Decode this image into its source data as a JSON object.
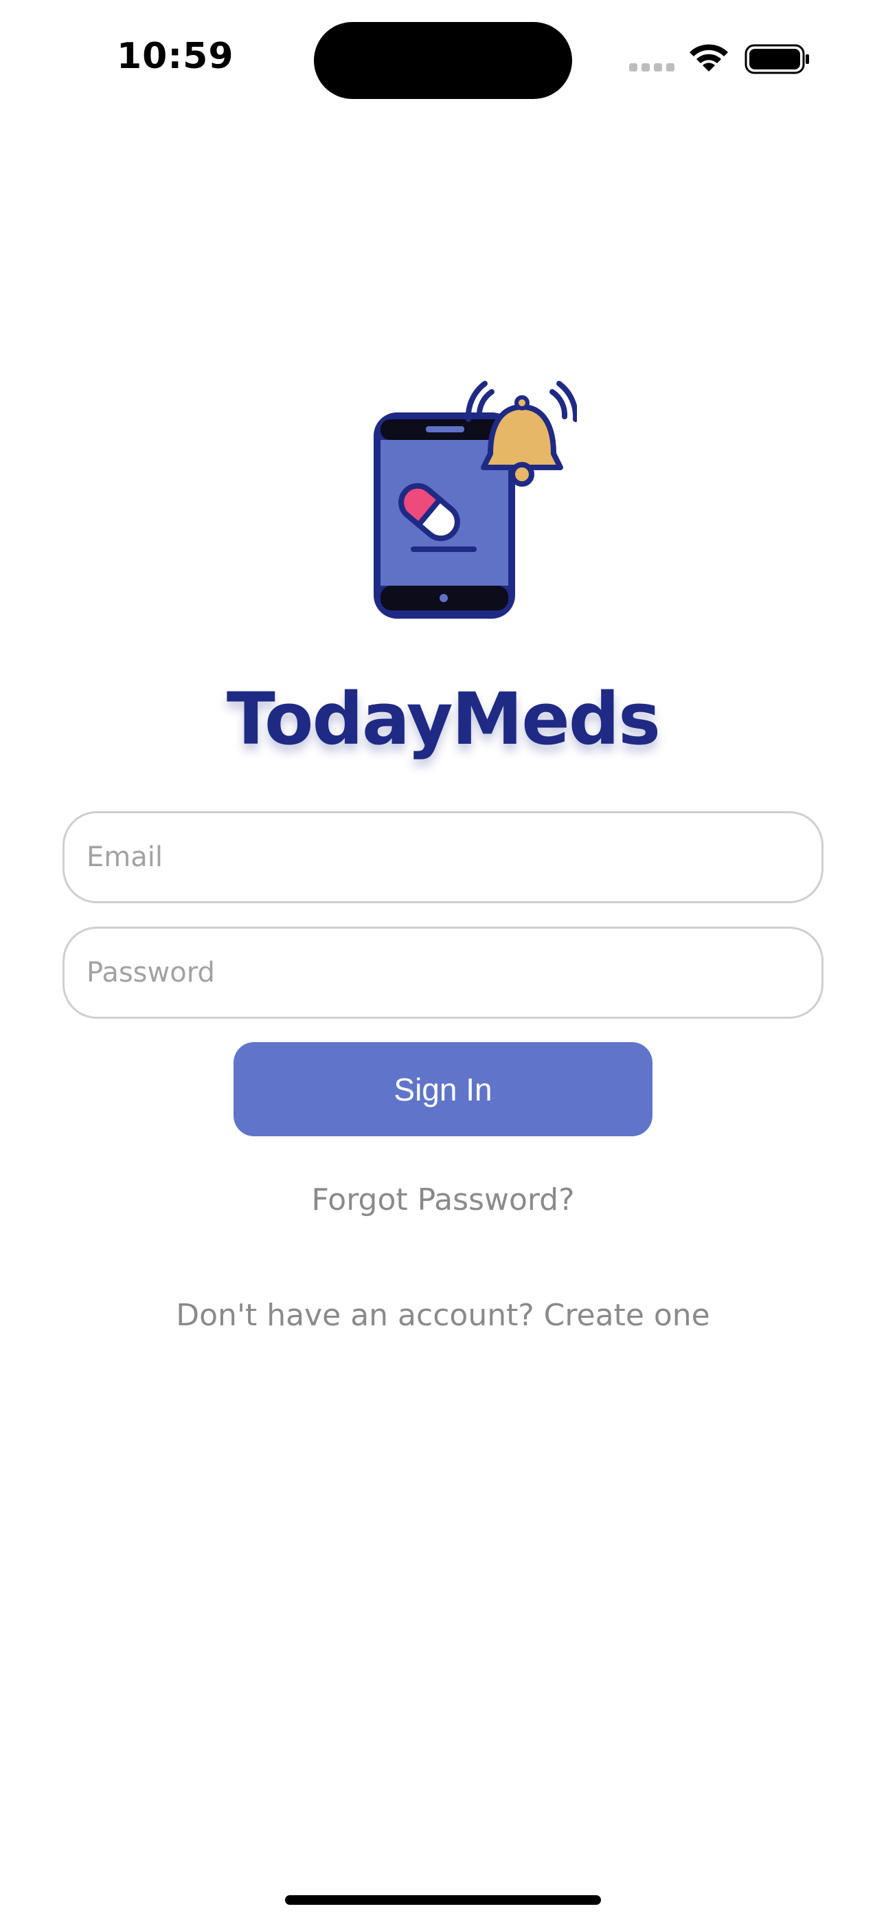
{
  "status_bar": {
    "time": "10:59"
  },
  "app": {
    "title": "TodayMeds",
    "logo_icon": "phone-pill-bell-icon",
    "colors": {
      "brand_navy": "#1f2a84",
      "button": "#6075c9",
      "bell": "#e6b766",
      "pill_pink": "#ef4a7c"
    }
  },
  "form": {
    "email_placeholder": "Email",
    "password_placeholder": "Password",
    "sign_in_label": "Sign In",
    "forgot_password_label": "Forgot Password?",
    "create_account_label": "Don't have an account? Create one"
  }
}
